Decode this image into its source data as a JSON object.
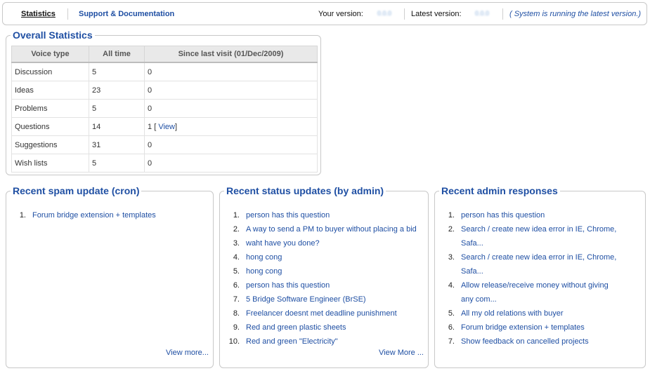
{
  "topbar": {
    "tab_statistics": "Statistics",
    "tab_support": "Support & Documentation",
    "your_version_label": "Your version:",
    "your_version_value": "0.0.0",
    "latest_version_label": "Latest version:",
    "latest_version_value": "0.0.0",
    "system_status": "( System is running the latest version.)"
  },
  "overall": {
    "title": "Overall Statistics",
    "headers": [
      "Voice type",
      "All time",
      "Since last visit (01/Dec/2009)"
    ],
    "rows": [
      {
        "type": "Discussion",
        "all_time": "5",
        "since": "0",
        "view": ""
      },
      {
        "type": "Ideas",
        "all_time": "23",
        "since": "0",
        "view": ""
      },
      {
        "type": "Problems",
        "all_time": "5",
        "since": "0",
        "view": ""
      },
      {
        "type": "Questions",
        "all_time": "14",
        "since": "1",
        "view": "View"
      },
      {
        "type": "Suggestions",
        "all_time": "31",
        "since": "0",
        "view": ""
      },
      {
        "type": "Wish lists",
        "all_time": "5",
        "since": "0",
        "view": ""
      }
    ]
  },
  "spam": {
    "title": "Recent spam update (cron)",
    "items": [
      "Forum bridge extension + templates"
    ],
    "view_more": "View more..."
  },
  "status_updates": {
    "title": "Recent status updates (by admin)",
    "items": [
      "person has this question",
      "A way to send a PM to buyer without placing a bid",
      "waht have you done?",
      "hong cong",
      "hong cong",
      "person has this question",
      "5 Bridge Software Engineer (BrSE)",
      "Freelancer doesnt met deadline punishment",
      "Red and green plastic sheets",
      "Red and green \"Electricity\""
    ],
    "view_more": "View More ..."
  },
  "admin_responses": {
    "title": "Recent admin responses",
    "items": [
      "person has this question",
      "Search / create new idea error in IE, Chrome, Safa...",
      "Search / create new idea error in IE, Chrome, Safa...",
      "Allow release/receive money without giving any com...",
      "All my old relations with buyer",
      "Forum bridge extension + templates",
      "Show feedback on cancelled projects"
    ]
  }
}
